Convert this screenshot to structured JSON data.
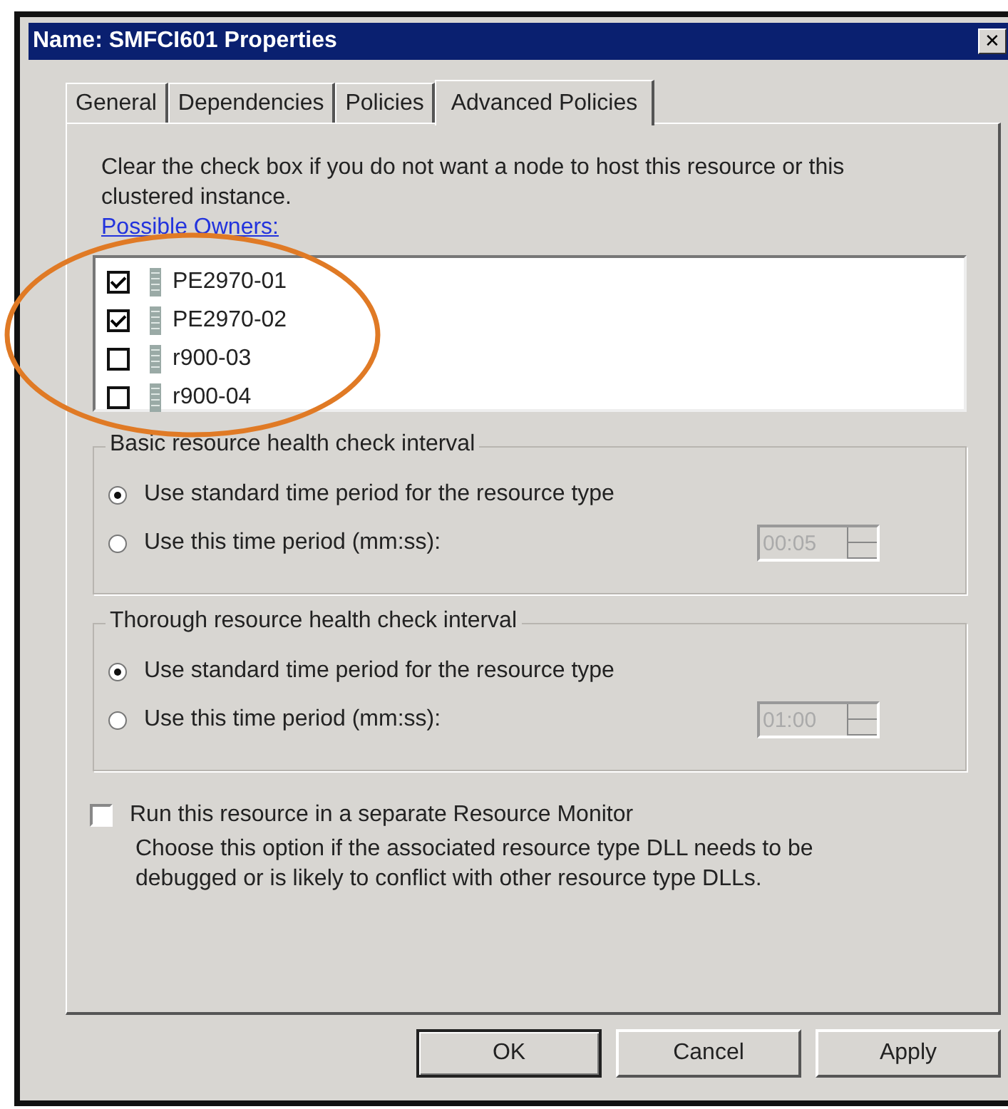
{
  "window": {
    "title": "Name: SMFCI601 Properties",
    "close": "✕"
  },
  "tabs": [
    {
      "label": "General",
      "selected": false
    },
    {
      "label": "Dependencies",
      "selected": false
    },
    {
      "label": "Policies",
      "selected": false
    },
    {
      "label": "Advanced Policies",
      "selected": true
    }
  ],
  "description": "Clear the check box if you do not want a node to host this resource or this clustered instance.",
  "owners_link": "Possible Owners:",
  "owners": [
    {
      "name": "PE2970-01",
      "checked": true
    },
    {
      "name": "PE2970-02",
      "checked": true
    },
    {
      "name": "r900-03",
      "checked": false
    },
    {
      "name": "r900-04",
      "checked": false
    }
  ],
  "groups": [
    {
      "legend": "Basic resource health check interval",
      "options": [
        {
          "label": "Use standard time period for the resource type",
          "selected": true
        },
        {
          "label": "Use this time period (mm:ss):",
          "selected": false
        }
      ],
      "time_value": "00:05"
    },
    {
      "legend": "Thorough resource health check interval",
      "options": [
        {
          "label": "Use standard time period for the resource type",
          "selected": true
        },
        {
          "label": "Use this time period (mm:ss):",
          "selected": false
        }
      ],
      "time_value": "01:00"
    }
  ],
  "monitor": {
    "label": "Run this resource in a separate Resource Monitor",
    "checked": false,
    "description": "Choose this option if the associated resource type DLL needs to be debugged or is likely to conflict with other resource type DLLs."
  },
  "buttons": [
    "OK",
    "Cancel",
    "Apply"
  ]
}
